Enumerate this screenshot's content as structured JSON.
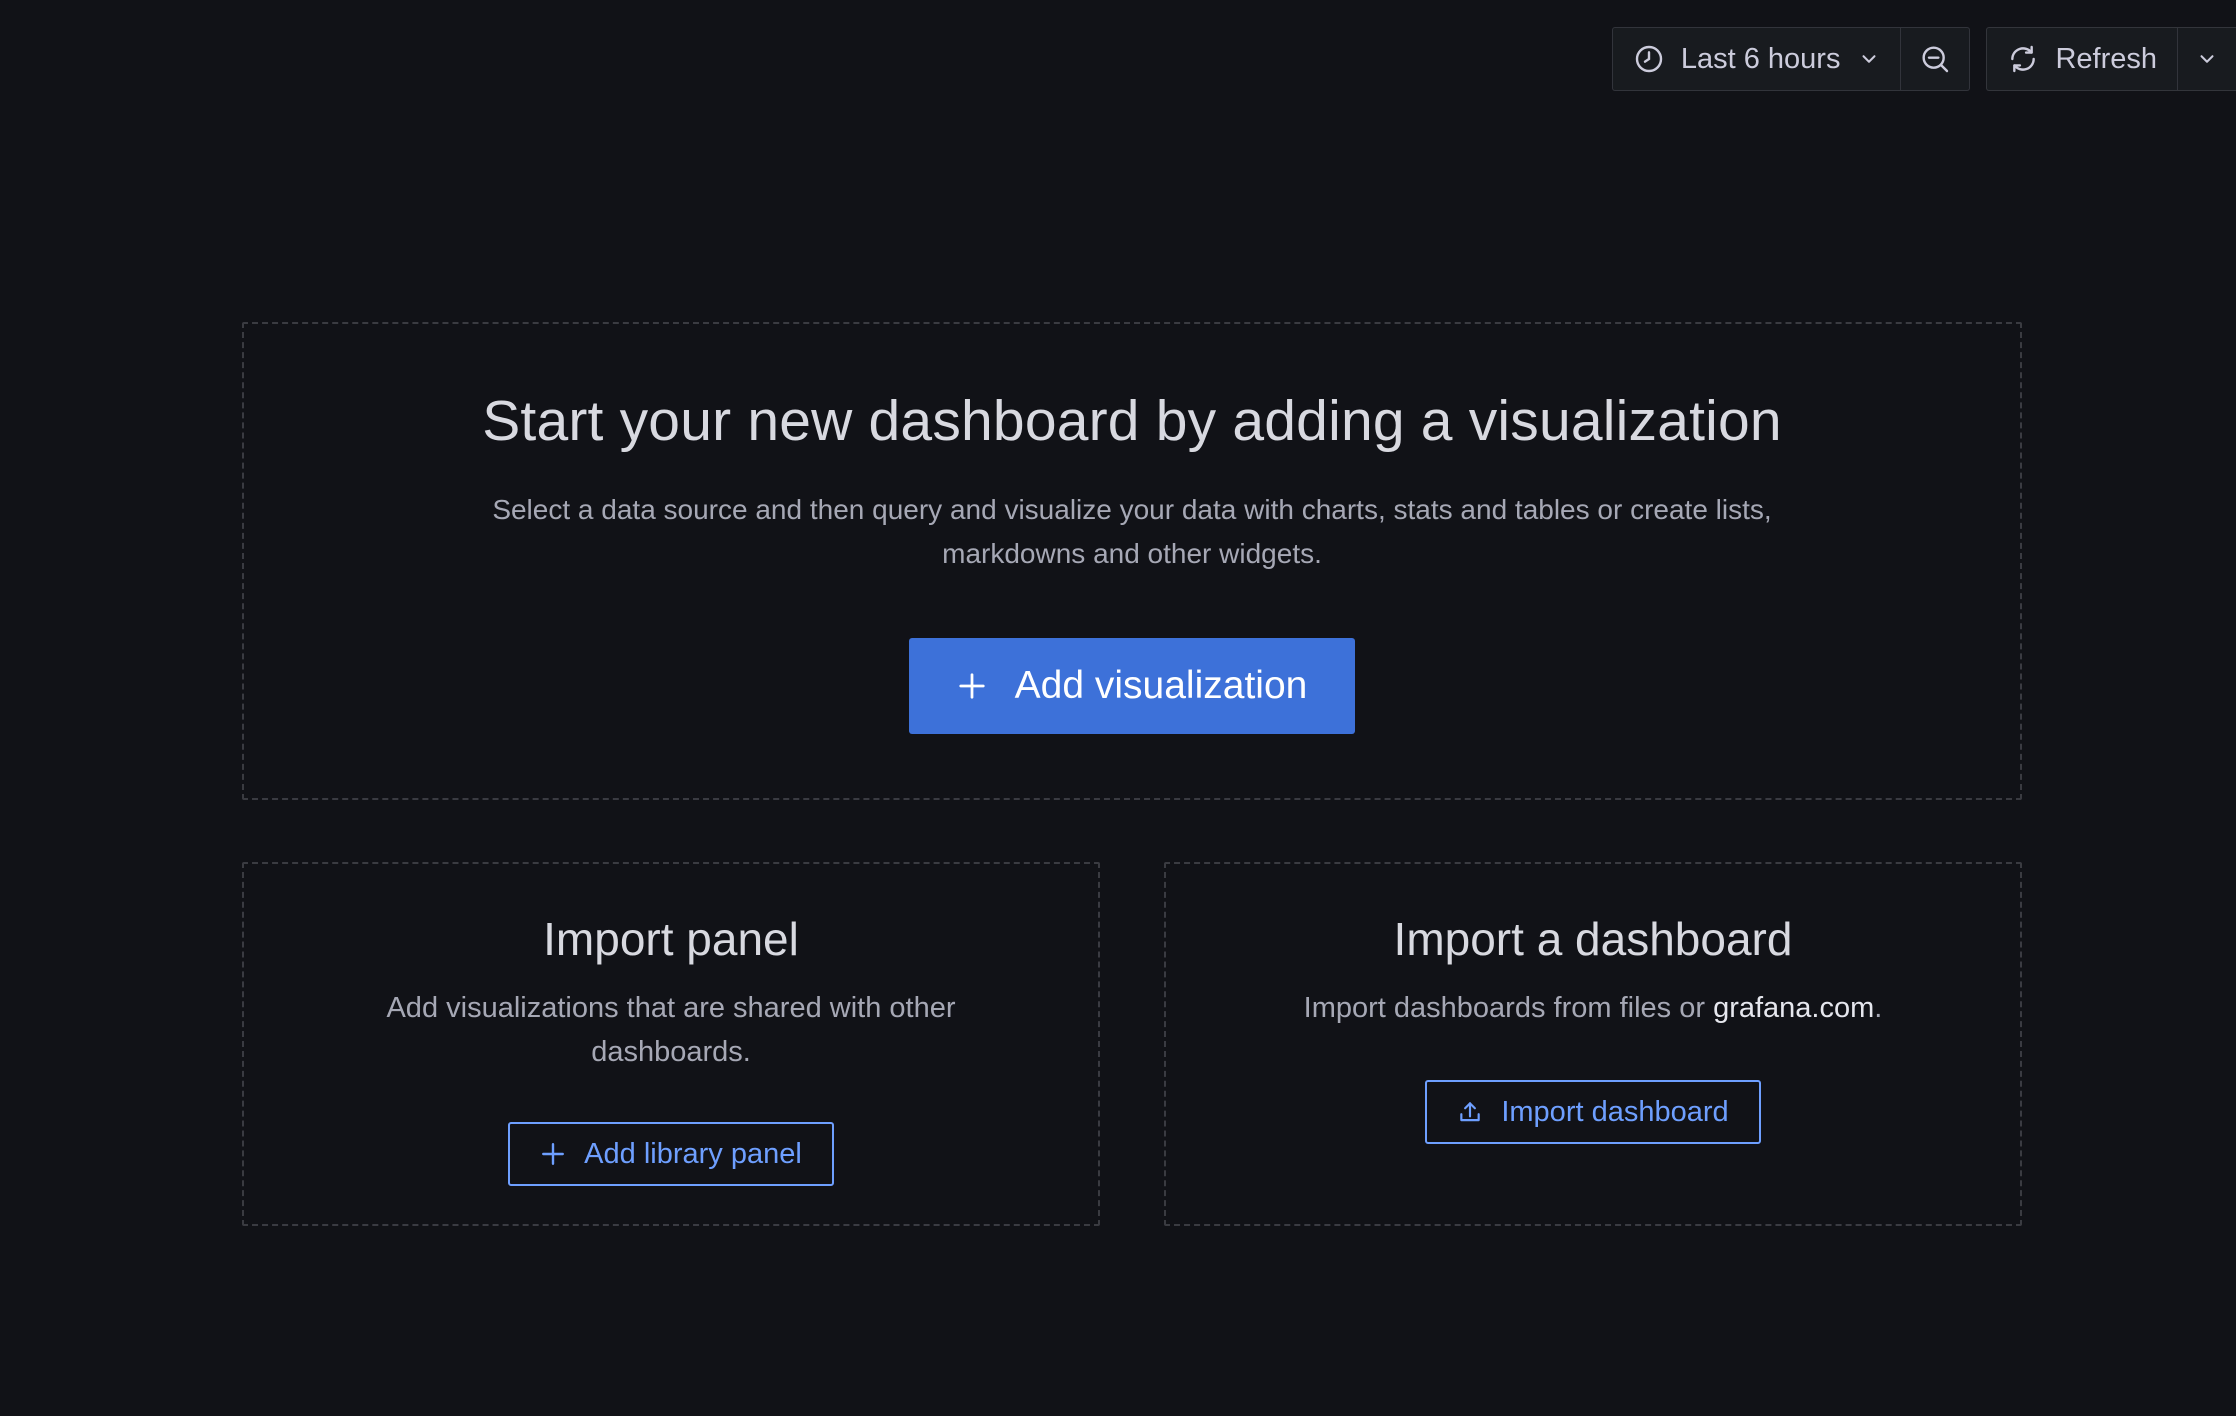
{
  "toolbar": {
    "time_range_label": "Last 6 hours",
    "refresh_label": "Refresh"
  },
  "empty_state": {
    "title": "Start your new dashboard by adding a visualization",
    "description": "Select a data source and then query and visualize your data with charts, stats and tables or create lists, markdowns and other widgets.",
    "button_label": "Add visualization"
  },
  "import_panel": {
    "title": "Import panel",
    "description": "Add visualizations that are shared with other dashboards.",
    "button_label": "Add library panel"
  },
  "import_dashboard": {
    "title": "Import a dashboard",
    "description_prefix": "Import dashboards from files or ",
    "link_text": "grafana.com",
    "description_suffix": ".",
    "button_label": "Import dashboard"
  },
  "colors": {
    "background": "#111217",
    "primary": "#3d71d9",
    "link": "#6e9fff"
  }
}
